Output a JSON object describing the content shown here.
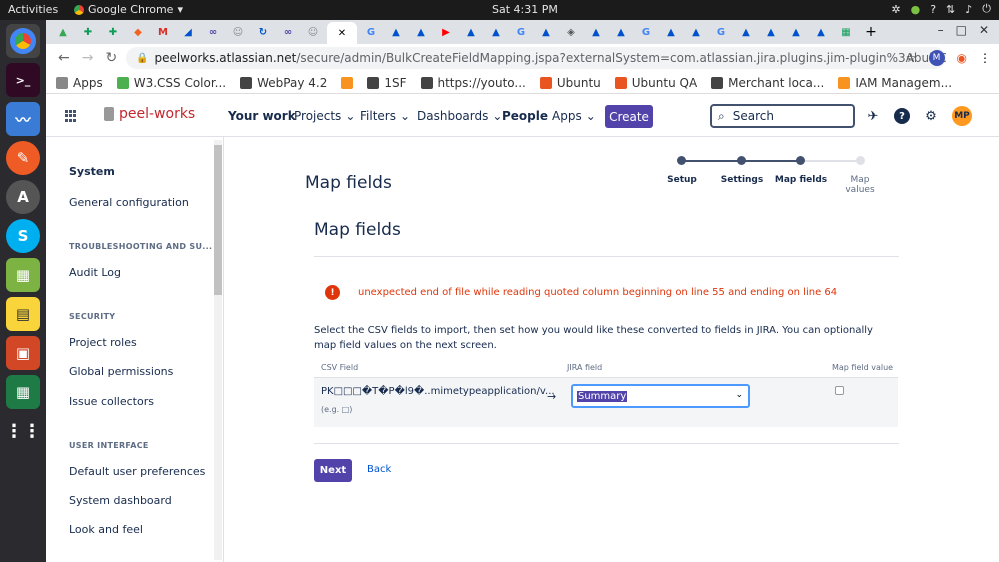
{
  "os": {
    "activities": "Activities",
    "app_name": "Google Chrome",
    "clock": "Sat  4:31 PM"
  },
  "browser": {
    "url_host": "peelworks.atlassian.net",
    "url_path": "/secure/admin/BulkCreateFieldMapping.jspa?externalSystem=com.atlassian.jira.plugins.jim-plugin%3AbulkCreateCsv",
    "profile_initial": "M",
    "bookmarks": [
      {
        "label": "Apps",
        "color": "#888888"
      },
      {
        "label": "W3.CSS Color...",
        "color": "#4caf50"
      },
      {
        "label": "WebPay 4.2",
        "color": "#444444"
      },
      {
        "label": "",
        "color": "#f7931e"
      },
      {
        "label": "1SF",
        "color": "#444444"
      },
      {
        "label": "https://youto...",
        "color": "#444444"
      },
      {
        "label": "Ubuntu",
        "color": "#e95420"
      },
      {
        "label": "Ubuntu QA",
        "color": "#e95420"
      },
      {
        "label": "Merchant loca...",
        "color": "#444444"
      },
      {
        "label": "IAM Managem...",
        "color": "#f7931e"
      }
    ]
  },
  "jira": {
    "logo": "peel-works",
    "nav": {
      "your_work": "Your work",
      "projects": "Projects",
      "filters": "Filters",
      "dashboards": "Dashboards",
      "people": "People",
      "apps": "Apps",
      "create": "Create",
      "search_placeholder": "Search",
      "avatar": "MP"
    },
    "sidebar": {
      "system": "System",
      "general_configuration": "General configuration",
      "troubleshooting_header": "TROUBLESHOOTING AND SU...",
      "audit_log": "Audit Log",
      "security_header": "SECURITY",
      "project_roles": "Project roles",
      "global_permissions": "Global permissions",
      "issue_collectors": "Issue collectors",
      "ui_header": "USER INTERFACE",
      "default_user_preferences": "Default user preferences",
      "system_dashboard": "System dashboard",
      "look_and_feel": "Look and feel"
    },
    "main": {
      "page_title": "Map fields",
      "steps": [
        "Setup",
        "Settings",
        "Map fields",
        "Map values"
      ],
      "section_title": "Map fields",
      "error": "unexpected end of file while reading quoted column beginning on line 55 and ending on line 64",
      "description": "Select the CSV fields to import, then set how you would like these converted to fields in JIRA. You can optionally map field values on the next screen.",
      "col_csv": "CSV Field",
      "col_jira": "JIRA field",
      "col_map": "Map field value",
      "csv_field_value": "PK□□□�T�P�l9�..mimetypeapplication/v...",
      "csv_example": "(e.g. □)",
      "jira_field_value": "Summary",
      "next": "Next",
      "back": "Back"
    }
  }
}
